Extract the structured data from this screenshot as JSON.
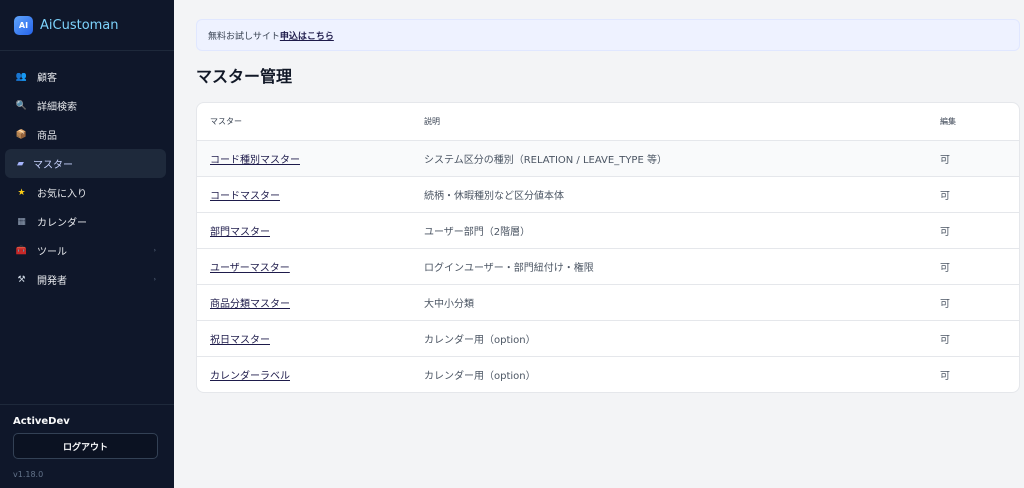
{
  "brand": {
    "logo_text": "AI",
    "name": "AiCustoman"
  },
  "sidebar": {
    "items": [
      {
        "label": "顧客",
        "icon": "users-icon",
        "glyph": "👥",
        "active": false
      },
      {
        "label": "詳細検索",
        "icon": "search-icon",
        "glyph": "🔍",
        "active": false
      },
      {
        "label": "商品",
        "icon": "box-icon",
        "glyph": "📦",
        "active": false
      },
      {
        "label": "マスター",
        "icon": "folder-icon",
        "glyph": "▰",
        "active": true
      },
      {
        "label": "お気に入り",
        "icon": "star-icon",
        "glyph": "★",
        "active": false
      },
      {
        "label": "カレンダー",
        "icon": "calendar-icon",
        "glyph": "▦",
        "active": false
      },
      {
        "label": "ツール",
        "icon": "toolbox-icon",
        "glyph": "🧰",
        "active": false,
        "expandable": true
      },
      {
        "label": "開発者",
        "icon": "tools-icon",
        "glyph": "⚒",
        "active": false,
        "expandable": true
      }
    ],
    "chevron": "›",
    "user_name": "ActiveDev",
    "logout_label": "ログアウト",
    "version": "v1.18.0"
  },
  "notice": {
    "text": "無料お試しサイト",
    "link_text": "申込はこちら"
  },
  "page_title": "マスター管理",
  "table": {
    "headers": [
      "マスター",
      "説明",
      "編集"
    ],
    "rows": [
      {
        "name": "コード種別マスター",
        "desc": "システム区分の種別（RELATION / LEAVE_TYPE 等）",
        "edit": "可"
      },
      {
        "name": "コードマスター",
        "desc": "続柄・休暇種別など区分値本体",
        "edit": "可"
      },
      {
        "name": "部門マスター",
        "desc": "ユーザー部門（2階層）",
        "edit": "可"
      },
      {
        "name": "ユーザーマスター",
        "desc": "ログインユーザー・部門紐付け・権限",
        "edit": "可"
      },
      {
        "name": "商品分類マスター",
        "desc": "大中小分類",
        "edit": "可"
      },
      {
        "name": "祝日マスター",
        "desc": "カレンダー用（option）",
        "edit": "可"
      },
      {
        "name": "カレンダーラベル",
        "desc": "カレンダー用（option）",
        "edit": "可"
      }
    ]
  },
  "colors": {
    "sidebar_bg": "#0f172a",
    "accent": "#1e1b4b",
    "brand_text": "#7dd3fc",
    "notice_bg": "#eef2ff"
  }
}
